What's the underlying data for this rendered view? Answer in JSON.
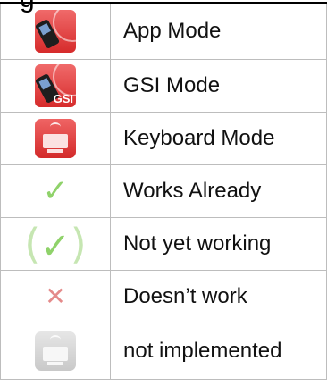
{
  "header": {
    "cut_title_fragment": "g"
  },
  "legend": {
    "rows": [
      {
        "icon": "app-mode-icon",
        "label": "App Mode"
      },
      {
        "icon": "gsi-mode-icon",
        "label": "GSI Mode",
        "icon_text": "GSI"
      },
      {
        "icon": "keyboard-mode-icon",
        "label": "Keyboard Mode"
      },
      {
        "icon": "checkmark-icon",
        "label": "Works Already"
      },
      {
        "icon": "parenthesized-checkmark-icon",
        "label": "Not yet working"
      },
      {
        "icon": "cross-icon",
        "label": "Doesn’t work"
      },
      {
        "icon": "grey-keyboard-icon",
        "label": "not implemented"
      }
    ]
  },
  "colors": {
    "mode_red": "#d62b2b",
    "check_green": "#8fd26a",
    "cross_red": "#e48a8a",
    "disabled_grey": "#c9c9c9",
    "grid_line": "#bdbdbd"
  }
}
